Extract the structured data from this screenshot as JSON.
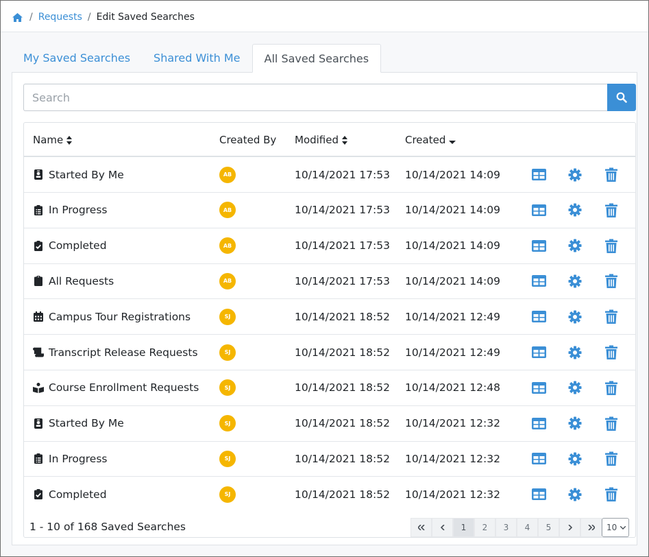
{
  "breadcrumb": {
    "home_icon": "home-icon",
    "requests": "Requests",
    "separator": "/",
    "current": "Edit Saved Searches"
  },
  "tabs": [
    {
      "label": "My Saved Searches",
      "active": false
    },
    {
      "label": "Shared With Me",
      "active": false
    },
    {
      "label": "All Saved Searches",
      "active": true
    }
  ],
  "search": {
    "placeholder": "Search",
    "value": "",
    "button_icon": "search-icon"
  },
  "table": {
    "headers": {
      "name": "Name",
      "created_by": "Created By",
      "modified": "Modified",
      "created": "Created"
    },
    "rows": [
      {
        "icon": "id-badge-icon",
        "name": "Started By Me",
        "created_by": "AB",
        "modified": "10/14/2021 17:53",
        "created": "10/14/2021 14:09"
      },
      {
        "icon": "clipboard-list-icon",
        "name": "In Progress",
        "created_by": "AB",
        "modified": "10/14/2021 17:53",
        "created": "10/14/2021 14:09"
      },
      {
        "icon": "clipboard-check-icon",
        "name": "Completed",
        "created_by": "AB",
        "modified": "10/14/2021 17:53",
        "created": "10/14/2021 14:09"
      },
      {
        "icon": "clipboard-icon",
        "name": "All Requests",
        "created_by": "AB",
        "modified": "10/14/2021 17:53",
        "created": "10/14/2021 14:09"
      },
      {
        "icon": "calendar-icon",
        "name": "Campus Tour Registrations",
        "created_by": "SJ",
        "modified": "10/14/2021 18:52",
        "created": "10/14/2021 12:49"
      },
      {
        "icon": "scroll-icon",
        "name": "Transcript Release Requests",
        "created_by": "SJ",
        "modified": "10/14/2021 18:52",
        "created": "10/14/2021 12:49"
      },
      {
        "icon": "book-reader-icon",
        "name": "Course Enrollment Requests",
        "created_by": "SJ",
        "modified": "10/14/2021 18:52",
        "created": "10/14/2021 12:48"
      },
      {
        "icon": "id-badge-icon",
        "name": "Started By Me",
        "created_by": "SJ",
        "modified": "10/14/2021 18:52",
        "created": "10/14/2021 12:32"
      },
      {
        "icon": "clipboard-list-icon",
        "name": "In Progress",
        "created_by": "SJ",
        "modified": "10/14/2021 18:52",
        "created": "10/14/2021 12:32"
      },
      {
        "icon": "clipboard-check-icon",
        "name": "Completed",
        "created_by": "SJ",
        "modified": "10/14/2021 18:52",
        "created": "10/14/2021 12:32"
      }
    ],
    "row_actions": [
      "table-view-icon",
      "gear-icon",
      "trash-icon"
    ]
  },
  "footer": {
    "count": "1 - 10 of 168 Saved Searches",
    "pages": [
      "1",
      "2",
      "3",
      "4",
      "5"
    ],
    "current_page": "1",
    "per_page": "10"
  },
  "colors": {
    "accent": "#3b8fd6",
    "avatar": "#f5b600"
  }
}
